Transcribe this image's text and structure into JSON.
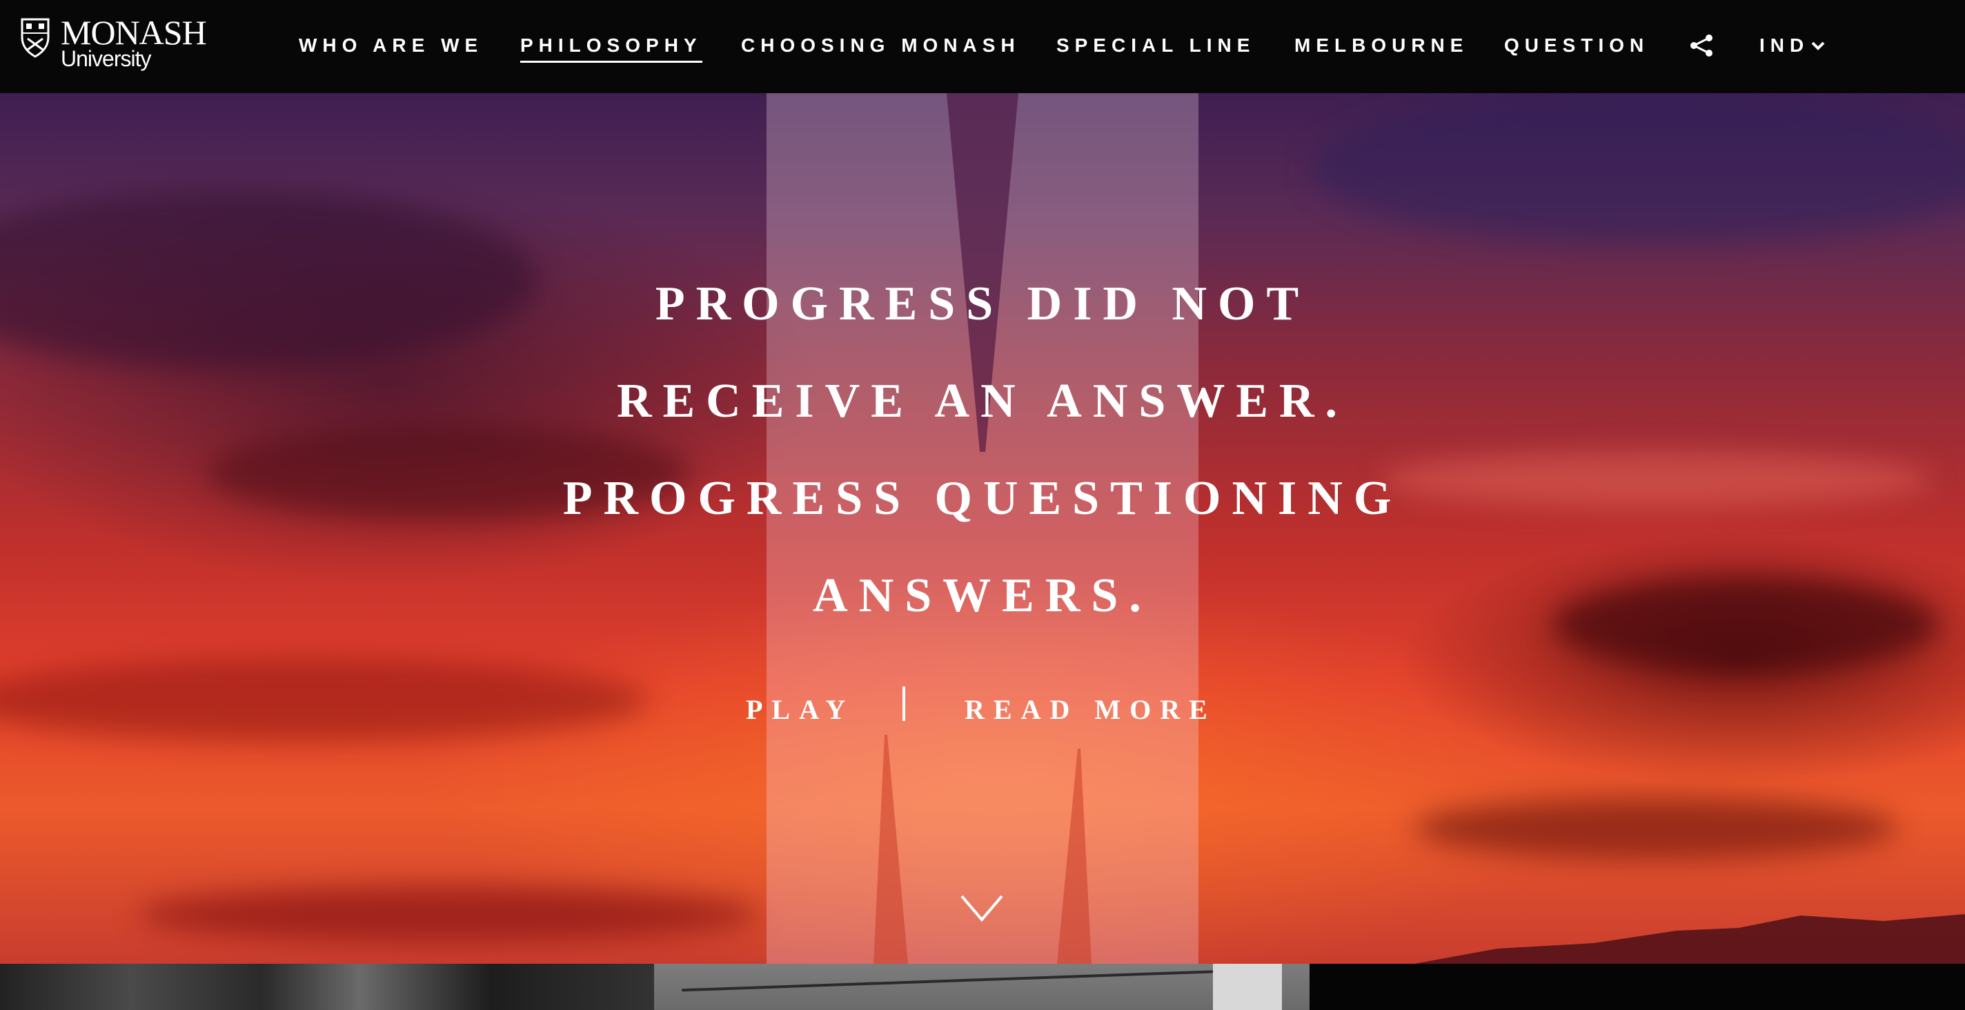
{
  "header": {
    "brand": "MONASH",
    "brand_sub": "University",
    "nav": [
      {
        "label": "WHO ARE WE",
        "active": false
      },
      {
        "label": "PHILOSOPHY",
        "active": true
      },
      {
        "label": "CHOOSING MONASH",
        "active": false
      },
      {
        "label": "SPECIAL LINE",
        "active": false
      },
      {
        "label": "MELBOURNE",
        "active": false
      },
      {
        "label": "QUESTION",
        "active": false
      }
    ],
    "share_icon": "share-icon",
    "language": "IND",
    "language_icon": "chevron-down-icon"
  },
  "hero": {
    "quote_lines": [
      "PROGRESS DID NOT",
      "RECEIVE AN ANSWER.",
      "PROGRESS QUESTIONING",
      "ANSWERS."
    ],
    "play_label": "PLAY",
    "read_more_label": "READ MORE",
    "scroll_icon": "chevron-down-icon"
  },
  "colors": {
    "nav_background": "#070707",
    "text": "#ffffff",
    "sky_top": "#3f1f52",
    "sky_bottom": "#ec5a2c"
  }
}
